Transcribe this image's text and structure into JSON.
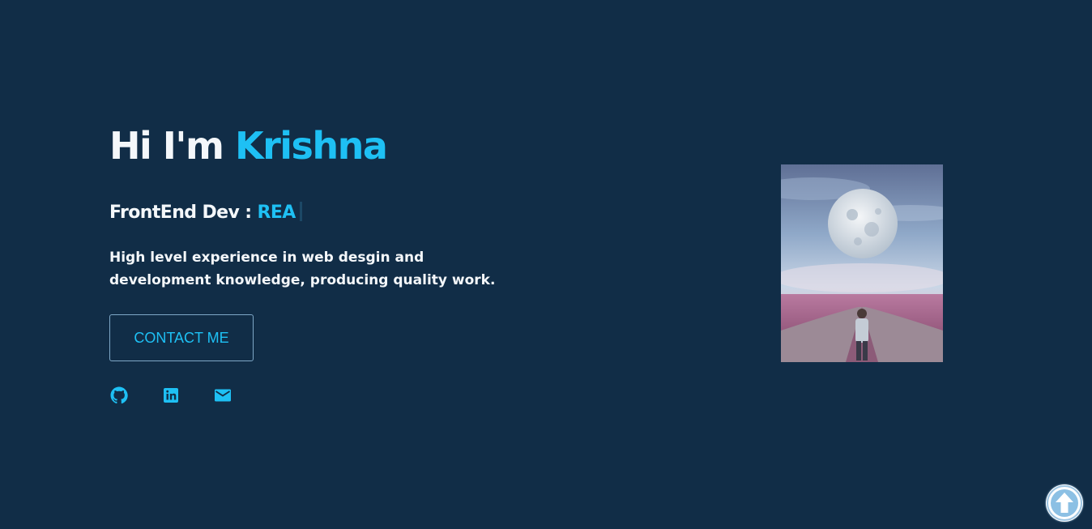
{
  "hero": {
    "greeting": "Hi I'm",
    "name": "Krishna",
    "role_prefix": "FrontEnd Dev :",
    "role_typed": "REA",
    "description": "High level experience in web desgin and development knowledge, producing quality work.",
    "contact_label": "CONTACT ME"
  },
  "socials": [
    {
      "icon": "github-icon"
    },
    {
      "icon": "linkedin-icon"
    },
    {
      "icon": "mail-icon"
    }
  ],
  "colors": {
    "background": "#112d47",
    "accent": "#1ec0f4",
    "text": "#f4f7fa"
  },
  "scroll_top": {
    "icon": "arrow-up-icon"
  }
}
